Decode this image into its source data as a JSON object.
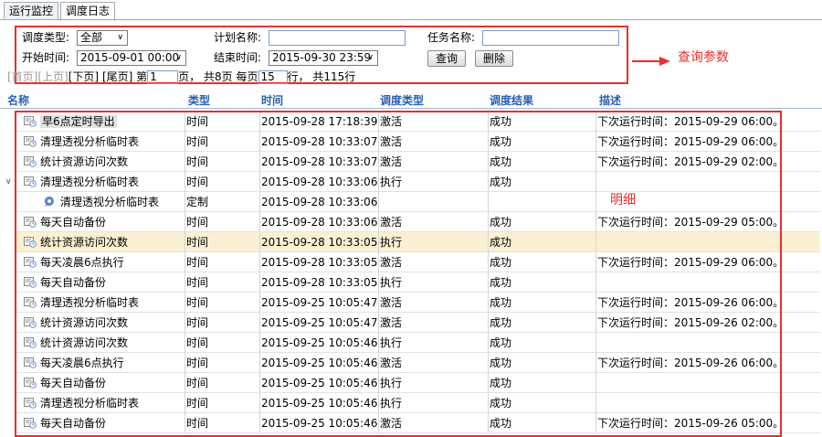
{
  "tabs": [
    {
      "label": "运行监控",
      "active": false
    },
    {
      "label": "调度日志",
      "active": true
    }
  ],
  "query": {
    "schedule_type_label": "调度类型:",
    "schedule_type_value": "全部",
    "plan_name_label": "计划名称:",
    "plan_name_value": "",
    "task_name_label": "任务名称:",
    "task_name_value": "",
    "start_time_label": "开始时间:",
    "start_time_value": "2015-09-01 00:00",
    "end_time_label": "结束时间:",
    "end_time_value": "2015-09-30 23:59",
    "search_button": "查询",
    "delete_button": "删除"
  },
  "pager": {
    "first": "[首页]",
    "prev": "[上页]",
    "next": "[下页]",
    "last": "[尾页]",
    "page_prefix": "第",
    "page_value": "1",
    "page_suffix": "页，",
    "total_pages": "共8页",
    "per_page_prefix": "每页",
    "per_page_value": "15",
    "per_page_suffix": "行，",
    "total_rows": "共115行"
  },
  "annotations": {
    "query_params": "查询参数",
    "detail": "明细",
    "color": "#e8302a"
  },
  "table": {
    "columns": [
      "名称",
      "类型",
      "时间",
      "调度类型",
      "调度结果",
      "描述"
    ],
    "rows": [
      {
        "name": "早6点定时导出",
        "type": "时间",
        "time": "2015-09-28 17:18:39",
        "sched": "激活",
        "result": "成功",
        "desc": "下次运行时间：2015-09-29 06:00。",
        "selected": true
      },
      {
        "name": "清理透视分析临时表",
        "type": "时间",
        "time": "2015-09-28 10:33:07",
        "sched": "激活",
        "result": "成功",
        "desc": "下次运行时间：2015-09-29 06:00。"
      },
      {
        "name": "统计资源访问次数",
        "type": "时间",
        "time": "2015-09-28 10:33:07",
        "sched": "激活",
        "result": "成功",
        "desc": "下次运行时间：2015-09-29 02:00。"
      },
      {
        "name": "清理透视分析临时表",
        "type": "时间",
        "time": "2015-09-28 10:33:06",
        "sched": "执行",
        "result": "成功",
        "desc": "",
        "expanded": true
      },
      {
        "name": "清理透视分析临时表",
        "type": "定制",
        "time": "2015-09-28 10:33:06",
        "sched": "",
        "result": "",
        "desc": "",
        "child": true
      },
      {
        "name": "每天自动备份",
        "type": "时间",
        "time": "2015-09-28 10:33:06",
        "sched": "激活",
        "result": "成功",
        "desc": "下次运行时间：2015-09-29 05:00。"
      },
      {
        "name": "统计资源访问次数",
        "type": "时间",
        "time": "2015-09-28 10:33:05",
        "sched": "执行",
        "result": "成功",
        "desc": "",
        "highlight": true
      },
      {
        "name": "每天凌晨6点执行",
        "type": "时间",
        "time": "2015-09-28 10:33:05",
        "sched": "激活",
        "result": "成功",
        "desc": "下次运行时间：2015-09-29 06:00。"
      },
      {
        "name": "每天自动备份",
        "type": "时间",
        "time": "2015-09-28 10:33:05",
        "sched": "执行",
        "result": "成功",
        "desc": ""
      },
      {
        "name": "清理透视分析临时表",
        "type": "时间",
        "time": "2015-09-25 10:05:47",
        "sched": "激活",
        "result": "成功",
        "desc": "下次运行时间：2015-09-26 06:00。"
      },
      {
        "name": "统计资源访问次数",
        "type": "时间",
        "time": "2015-09-25 10:05:47",
        "sched": "激活",
        "result": "成功",
        "desc": "下次运行时间：2015-09-26 02:00。"
      },
      {
        "name": "统计资源访问次数",
        "type": "时间",
        "time": "2015-09-25 10:05:46",
        "sched": "执行",
        "result": "成功",
        "desc": ""
      },
      {
        "name": "每天凌晨6点执行",
        "type": "时间",
        "time": "2015-09-25 10:05:46",
        "sched": "激活",
        "result": "成功",
        "desc": "下次运行时间：2015-09-26 06:00。"
      },
      {
        "name": "每天自动备份",
        "type": "时间",
        "time": "2015-09-25 10:05:46",
        "sched": "执行",
        "result": "成功",
        "desc": ""
      },
      {
        "name": "清理透视分析临时表",
        "type": "时间",
        "time": "2015-09-25 10:05:46",
        "sched": "执行",
        "result": "成功",
        "desc": ""
      },
      {
        "name": "每天自动备份",
        "type": "时间",
        "time": "2015-09-25 10:05:46",
        "sched": "激活",
        "result": "成功",
        "desc": "下次运行时间：2015-09-26 05:00。"
      }
    ]
  }
}
